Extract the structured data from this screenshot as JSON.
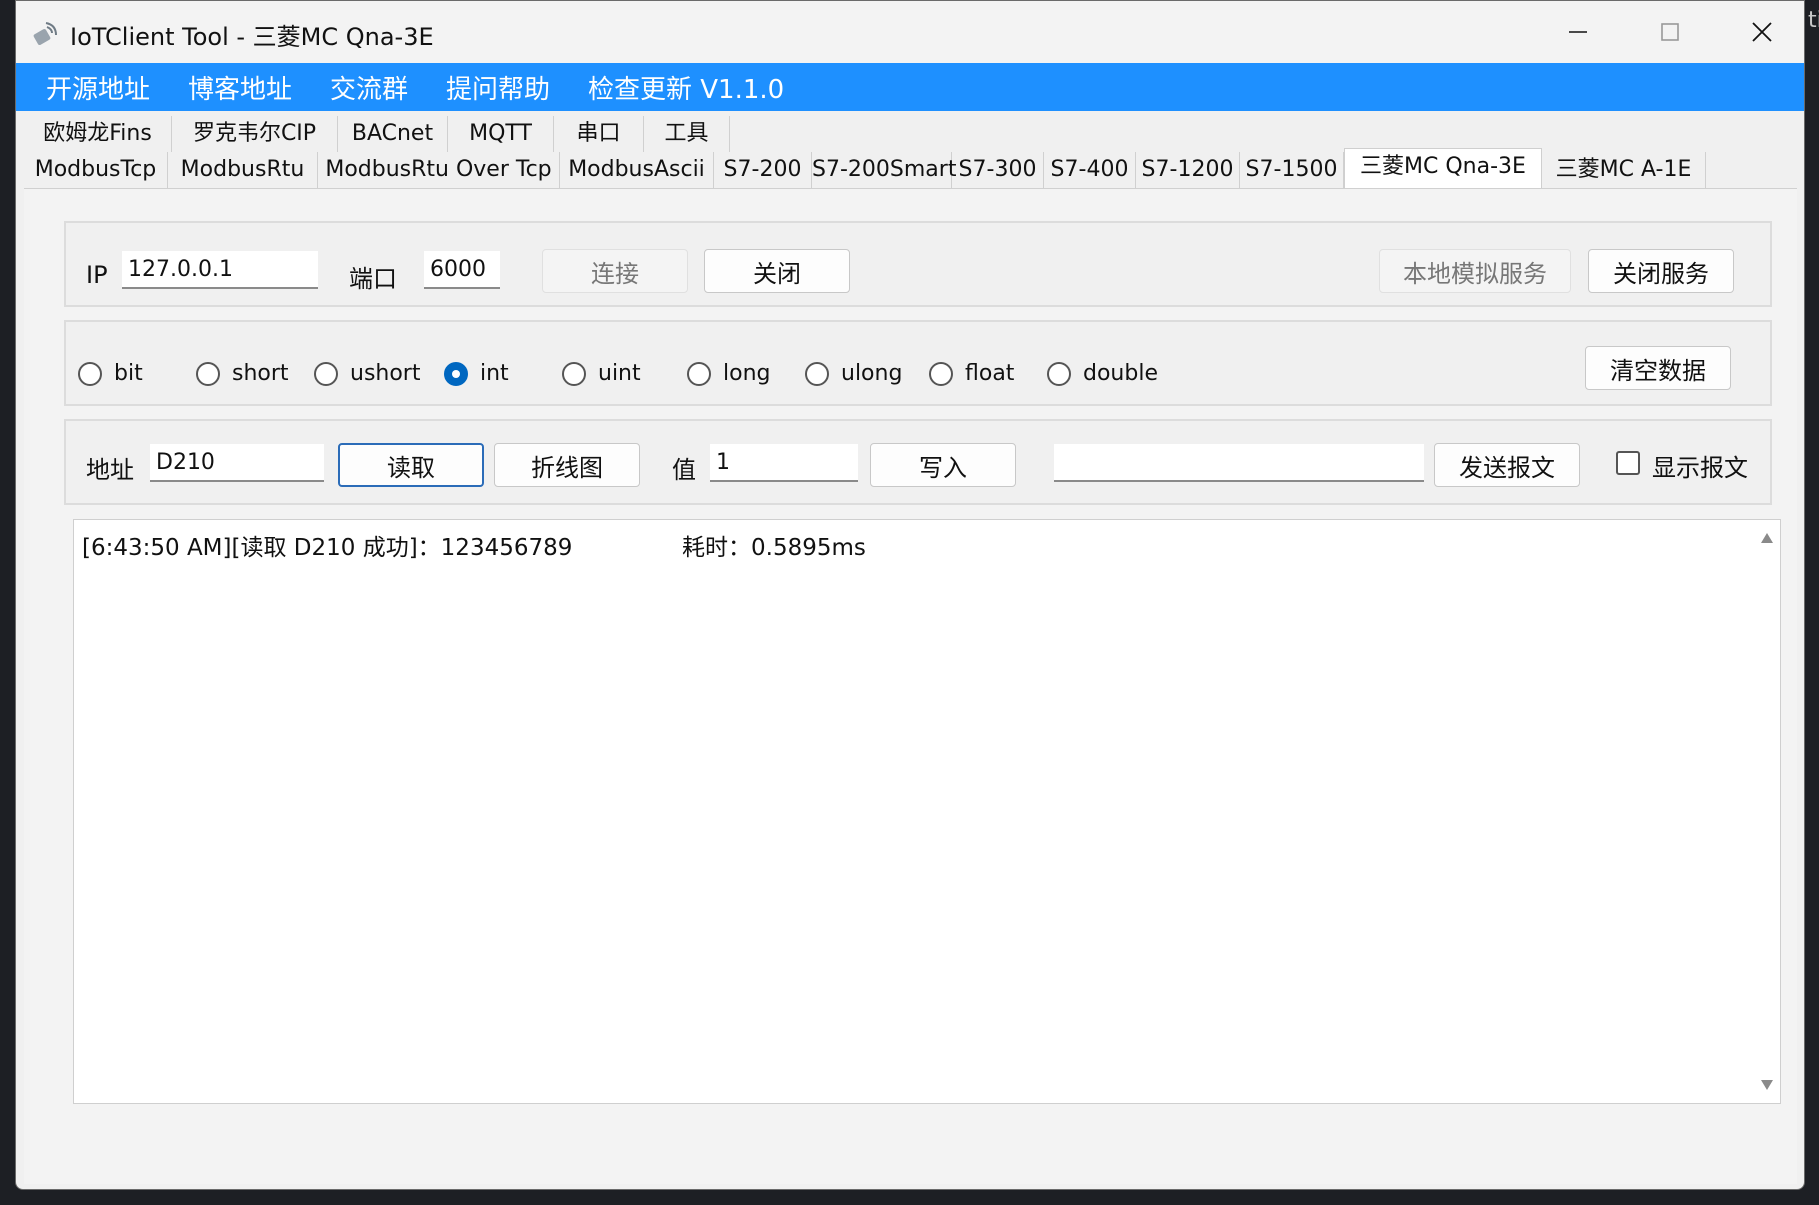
{
  "window": {
    "title": "IoTClient Tool - 三菱MC Qna-3E",
    "controls": {
      "minimize": "—",
      "maximize": "☐",
      "close": "✕"
    }
  },
  "menu": {
    "items": [
      "开源地址",
      "博客地址",
      "交流群",
      "提问帮助",
      "检查更新  V1.1.0"
    ]
  },
  "tabs_row1": [
    "欧姆龙Fins",
    "罗克韦尔CIP",
    "BACnet",
    "MQTT",
    "串口",
    "工具"
  ],
  "tabs_row2": [
    "ModbusTcp",
    "ModbusRtu",
    "ModbusRtu Over Tcp",
    "ModbusAscii",
    "S7-200",
    "S7-200Smart",
    "S7-300",
    "S7-400",
    "S7-1200",
    "S7-1500",
    "三菱MC Qna-3E",
    "三菱MC A-1E"
  ],
  "active_tab": "三菱MC Qna-3E",
  "connection": {
    "ip_label": "IP",
    "ip_value": "127.0.0.1",
    "port_label": "端口",
    "port_value": "6000",
    "connect_button": "连接",
    "close_button": "关闭",
    "local_sim_button": "本地模拟服务",
    "close_service_button": "关闭服务"
  },
  "types": {
    "options": [
      "bit",
      "short",
      "ushort",
      "int",
      "uint",
      "long",
      "ulong",
      "float",
      "double"
    ],
    "selected": "int",
    "clear_button": "清空数据"
  },
  "operation": {
    "address_label": "地址",
    "address_value": "D210",
    "read_button": "读取",
    "chart_button": "折线图",
    "value_label": "值",
    "value_value": "1",
    "write_button": "写入",
    "packet_value": "",
    "send_button": "发送报文",
    "show_packet_label": "显示报文"
  },
  "log": {
    "lines": [
      "[6:43:50 AM][读取 D210 成功]：123456789               耗时：0.5895ms"
    ]
  },
  "colors": {
    "menubar": "#1e90ff",
    "radio_selected": "#0067c0"
  }
}
